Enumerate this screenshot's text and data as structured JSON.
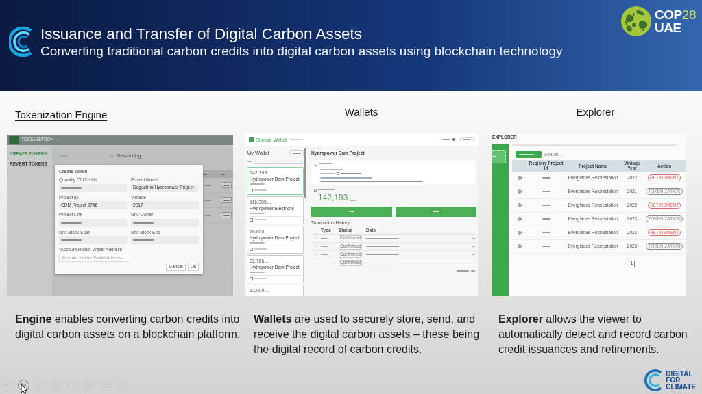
{
  "header": {
    "title": "Issuance and Transfer of Digital Carbon Assets",
    "subtitle": "Converting traditional carbon credits into digital carbon assets using blockchain technology"
  },
  "event_logo": {
    "event": "COP",
    "edition": "28",
    "host": "UAE"
  },
  "sections": [
    {
      "kind": "engine",
      "heading": "Tokenization Engine",
      "screenshot": {
        "app_name": "TOKENIZATION",
        "nav": [
          {
            "label": "CREATE TOKENS",
            "selected": true
          },
          {
            "label": "REVERT TOKENS",
            "selected": false
          }
        ],
        "sort": "Descending",
        "dialog": {
          "title": "Create Token",
          "fields": [
            {
              "label": "Quantity Of Credits"
            },
            {
              "label": "Project Name",
              "value": "Dagachhu Hydropower Project"
            },
            {
              "label": "Project ID",
              "value": "CDM Project 2746"
            },
            {
              "label": "Vintage",
              "value": "2017"
            },
            {
              "label": "Project Link"
            },
            {
              "label": "Unit Owner"
            },
            {
              "label": "Unit Block Start"
            },
            {
              "label": "Unit Block End"
            }
          ],
          "wallet_field": {
            "label": "*Account Holder Wallet Address",
            "placeholder": "Account Holder Wallet Address"
          },
          "buttons": [
            "Cancel",
            "Ok"
          ]
        }
      },
      "description": "**Engine** enables converting carbon credits into digital carbon assets on a blockchain platform."
    },
    {
      "kind": "wallet",
      "heading": "Wallets",
      "screenshot": {
        "app_name": "Climate Wallet",
        "panel_title": "My Wallet",
        "cards": [
          {
            "amount": "142,193",
            "name": "Hydropower Dam Project",
            "selected": true
          },
          {
            "amount": "116,385",
            "name": "Hydropower Electricity",
            "selected": false
          },
          {
            "amount": "76,000",
            "name": "Hydropower Dam Project",
            "selected": false
          },
          {
            "amount": "22,766",
            "name": "Hydropower Dam Project",
            "selected": false
          },
          {
            "amount": "12,000",
            "selected": false
          }
        ],
        "project_title": "Hydropower Dam Project",
        "balance": "142,193",
        "history_title": "Transaction History",
        "history_columns": [
          "Type",
          "Status",
          "Date"
        ],
        "history_rows": [
          {
            "status": "Confirmed"
          },
          {
            "status": "Confirmed"
          },
          {
            "status": "Confirmed"
          },
          {
            "status": "Confirmed"
          }
        ]
      },
      "description": "**Wallets** are used to securely store, send, and receive the digital carbon assets – these being the digital record of carbon credits."
    },
    {
      "kind": "explorer",
      "heading": "Explorer",
      "screenshot": {
        "app_name": "EXPLORER",
        "nav": [
          {
            "selected": true
          }
        ],
        "search": {
          "placeholder": "Search..."
        },
        "columns": [
          "Registry Project Id",
          "Project Name",
          "Vintage Year",
          "Action"
        ],
        "rows": [
          {
            "project": "Everglades Reforestation",
            "year": "2022",
            "action": "RETIREMENT",
            "color": "#dd6b6b"
          },
          {
            "project": "Everglades Reforestation",
            "year": "2021",
            "action": "TOKENIZATION",
            "color": "#8a8a8a"
          },
          {
            "project": "Everglades Reforestation",
            "year": "2022",
            "action": "RETIREMENT",
            "color": "#dd6b6b"
          },
          {
            "project": "Everglades Reforestation",
            "year": "2023",
            "action": "TOKENIZATION",
            "color": "#8a8a8a"
          },
          {
            "project": "Everglades Reforestation",
            "year": "2023",
            "action": "RETIREMENT",
            "color": "#dd6b6b"
          },
          {
            "project": "Everglades Reforestation",
            "year": "2023",
            "action": "TOKENIZATION",
            "color": "#8a8a8a"
          }
        ],
        "pages": [
          {
            "label": "1",
            "selected": true
          }
        ]
      },
      "description": "**Explorer** allows the viewer to automatically detect and record carbon credit issuances and retirements."
    }
  ],
  "presenter_toolbar": [
    {
      "kind": "back",
      "hovered": false
    },
    {
      "kind": "pointer",
      "hovered": true
    },
    {
      "kind": "pen",
      "hovered": false
    },
    {
      "kind": "slides",
      "hovered": false
    },
    {
      "kind": "zoom",
      "hovered": false
    },
    {
      "kind": "captions",
      "hovered": false
    },
    {
      "kind": "camera_off",
      "hovered": false
    },
    {
      "kind": "more",
      "hovered": false
    }
  ],
  "footer_logo": {
    "lines": [
      "DIGITAL",
      "FOR",
      "CLIMATE"
    ]
  }
}
